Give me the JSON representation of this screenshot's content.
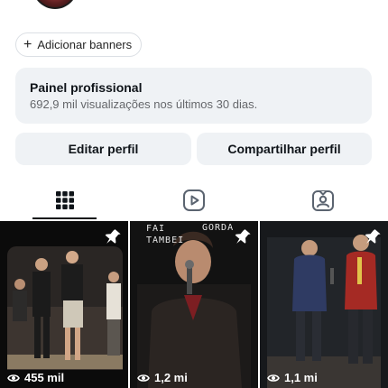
{
  "profile": {
    "banners_button": {
      "icon": "plus-icon",
      "label": "Adicionar banners"
    }
  },
  "professional_panel": {
    "title": "Painel profissional",
    "subtitle": "692,9 mil visualizações nos últimos 30 dias."
  },
  "actions": {
    "edit_profile": "Editar perfil",
    "share_profile": "Compartilhar perfil"
  },
  "tabs": [
    {
      "icon": "grid-icon",
      "active": true
    },
    {
      "icon": "reels-icon",
      "active": false
    },
    {
      "icon": "tagged-icon",
      "active": false
    }
  ],
  "posts": [
    {
      "views": "455 mil",
      "pinned": true,
      "caption_left": "",
      "caption_right": ""
    },
    {
      "views": "1,2 mi",
      "pinned": true,
      "caption_left": "FAI\nTAMBEI",
      "caption_right": "GORDA"
    },
    {
      "views": "1,1 mi",
      "pinned": true,
      "caption_left": "",
      "caption_right": ""
    }
  ],
  "colors": {
    "panel_bg": "#eff2f5",
    "text_primary": "#0f1419",
    "text_secondary": "#65676b"
  }
}
